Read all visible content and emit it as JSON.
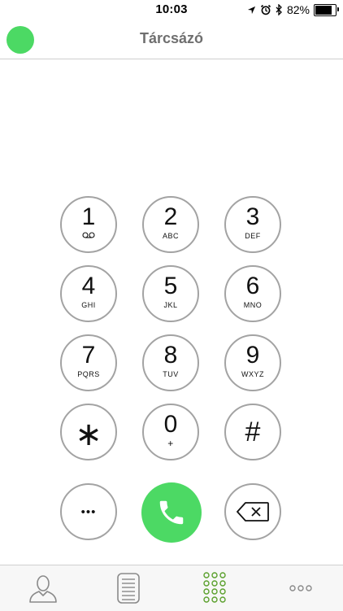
{
  "status_bar": {
    "time": "10:03",
    "battery_percent": "82%",
    "battery_level": 0.82,
    "icons": [
      "location-arrow-icon",
      "alarm-icon",
      "bluetooth-icon",
      "battery-icon"
    ]
  },
  "navbar": {
    "title": "Tárcsázó",
    "status_color": "#4cd964"
  },
  "keypad": {
    "keys": [
      {
        "digit": "1",
        "letters": ""
      },
      {
        "digit": "2",
        "letters": "ABC"
      },
      {
        "digit": "3",
        "letters": "DEF"
      },
      {
        "digit": "4",
        "letters": "GHI"
      },
      {
        "digit": "5",
        "letters": "JKL"
      },
      {
        "digit": "6",
        "letters": "MNO"
      },
      {
        "digit": "7",
        "letters": "PQRS"
      },
      {
        "digit": "8",
        "letters": "TUV"
      },
      {
        "digit": "9",
        "letters": "WXYZ"
      },
      {
        "digit": "∗",
        "letters": ""
      },
      {
        "digit": "0",
        "letters": "+"
      },
      {
        "digit": "#",
        "letters": ""
      }
    ],
    "more_symbol": "•••",
    "call_color": "#4cd964"
  },
  "tab_bar": {
    "tabs": [
      {
        "icon": "contacts-person-icon"
      },
      {
        "icon": "recents-list-icon"
      },
      {
        "icon": "keypad-grid-icon",
        "active": true,
        "active_color": "#5aa02c"
      },
      {
        "icon": "more-dots-icon"
      }
    ]
  }
}
